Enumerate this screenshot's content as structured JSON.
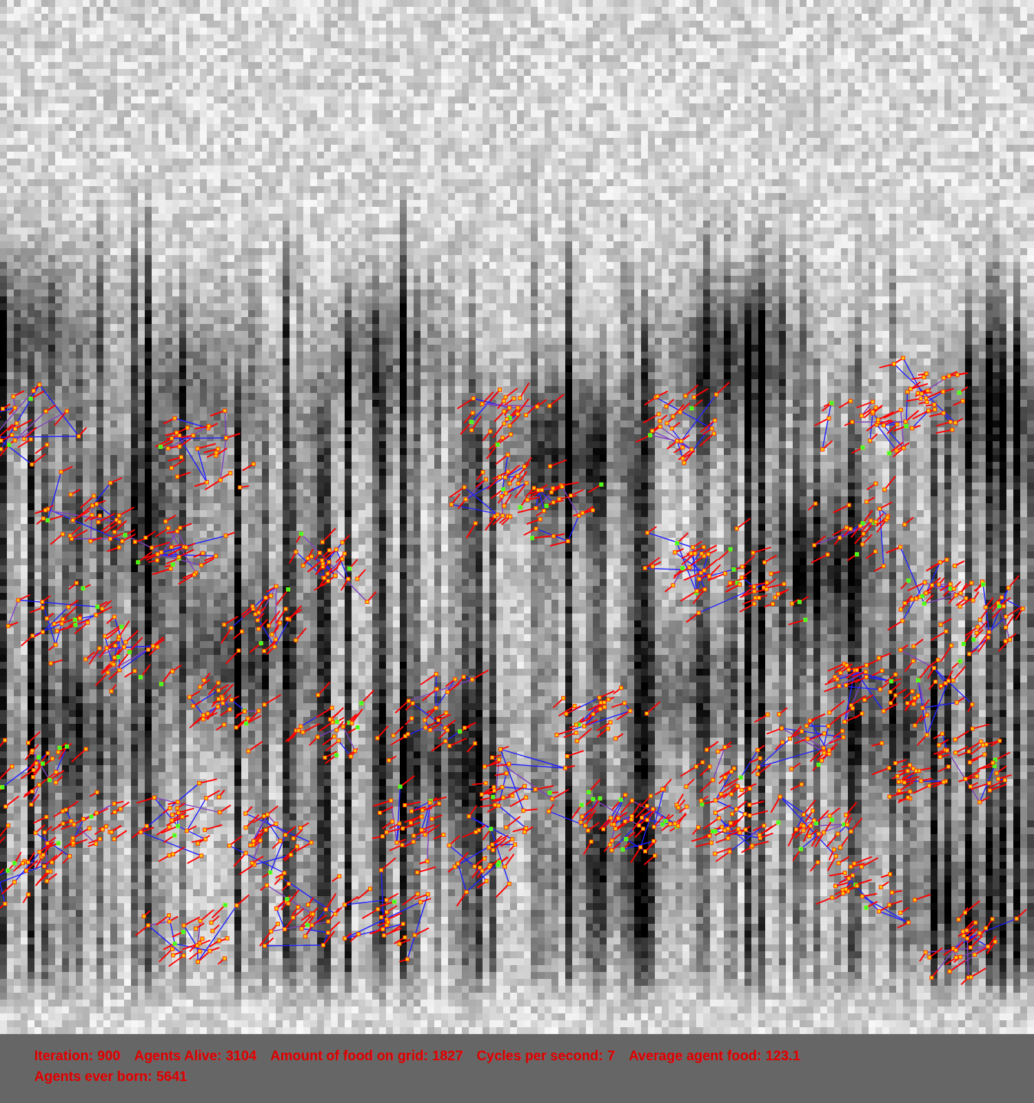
{
  "status_bar": {
    "lines": [
      [
        {
          "label": "Iteration:",
          "value": "900"
        },
        {
          "label": "Agents Alive:",
          "value": "3104"
        },
        {
          "label": "Amount of food on grid:",
          "value": "1827"
        },
        {
          "label": "Cycles per second:",
          "value": "7"
        },
        {
          "label": "Average agent food:",
          "value": "123.1"
        }
      ],
      [
        {
          "label": "Agents ever born:",
          "value": "5641"
        }
      ]
    ]
  }
}
